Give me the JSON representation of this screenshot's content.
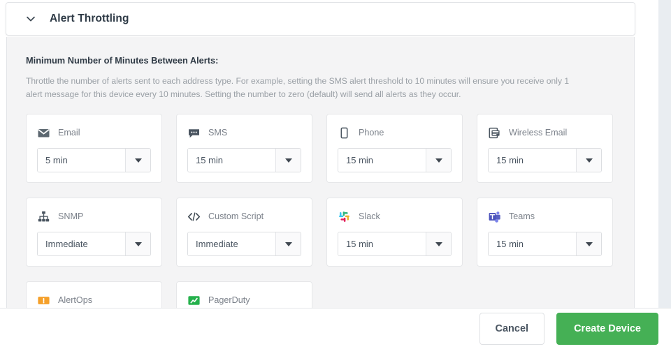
{
  "section": {
    "title": "Alert Throttling",
    "chevron_icon": "chevron-down-icon",
    "expanded": true
  },
  "panel": {
    "heading": "Minimum Number of Minutes Between Alerts:",
    "description": "Throttle the number of alerts sent to each address type. For example, setting the SMS alert threshold to 10 minutes will ensure you receive only 1 alert message for this device every 10 minutes. Setting the number to zero (default) will send all alerts as they occur."
  },
  "channels": [
    {
      "label": "Email",
      "icon": "envelope-icon",
      "value": "5 min"
    },
    {
      "label": "SMS",
      "icon": "chat-bubble-icon",
      "value": "15 min"
    },
    {
      "label": "Phone",
      "icon": "mobile-phone-icon",
      "value": "15 min"
    },
    {
      "label": "Wireless Email",
      "icon": "wireless-email-icon",
      "value": "15 min"
    },
    {
      "label": "SNMP",
      "icon": "network-tree-icon",
      "value": "Immediate"
    },
    {
      "label": "Custom Script",
      "icon": "code-brackets-icon",
      "value": "Immediate"
    },
    {
      "label": "Slack",
      "icon": "slack-icon",
      "value": "15 min"
    },
    {
      "label": "Teams",
      "icon": "microsoft-teams-icon",
      "value": "15 min"
    },
    {
      "label": "AlertOps",
      "icon": "alertops-icon",
      "value": ""
    },
    {
      "label": "PagerDuty",
      "icon": "pagerduty-icon",
      "value": ""
    }
  ],
  "footer": {
    "cancel_label": "Cancel",
    "create_label": "Create Device"
  },
  "colors": {
    "accent_green": "#45b055",
    "panel_bg": "#f4f4f5",
    "card_border": "#e6e7e9",
    "muted_text": "#9aa0a6",
    "heading_text": "#2f3a45"
  }
}
